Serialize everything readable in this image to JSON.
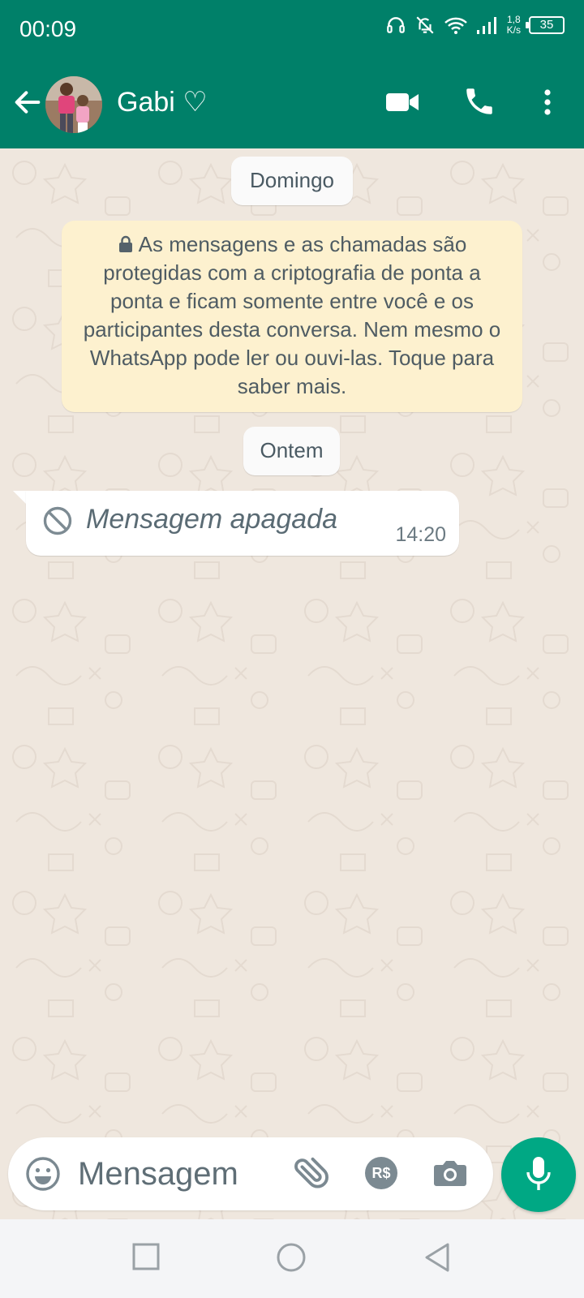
{
  "status_bar": {
    "time": "00:09",
    "net_speed_value": "1,8",
    "net_speed_unit": "K/s",
    "battery": "35",
    "icons": [
      "headphones-icon",
      "muted-bell-icon",
      "wifi-icon",
      "signal-icon",
      "battery-icon"
    ]
  },
  "header": {
    "contact_name": "Gabi ♡",
    "colors": {
      "header_bg": "#008069"
    },
    "icons": [
      "back-arrow-icon",
      "avatar",
      "video-call-icon",
      "phone-icon",
      "more-vert-icon"
    ]
  },
  "chat": {
    "date_chips": [
      "Domingo",
      "Ontem"
    ],
    "encryption_notice": "As mensagens e as chamadas são protegidas com a criptografia de ponta a ponta e ficam somente entre você e os participantes desta conversa. Nem mesmo o WhatsApp pode ler ou ouvi-las. Toque para saber mais.",
    "messages": [
      {
        "text": "Mensagem apagada",
        "time": "14:20",
        "deleted": true
      }
    ]
  },
  "composer": {
    "placeholder": "Mensagem",
    "payment_label": "R$",
    "colors": {
      "mic_button": "#00a884"
    }
  }
}
